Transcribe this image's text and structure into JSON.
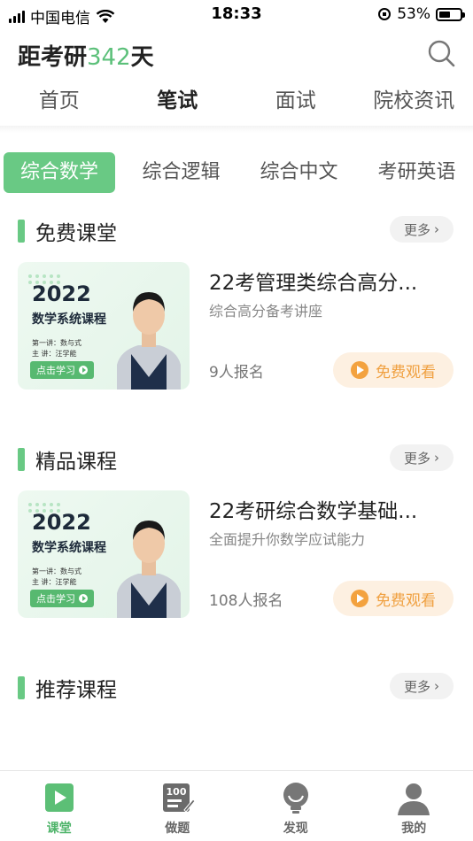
{
  "status_bar": {
    "carrier": "中国电信",
    "time": "18:33",
    "battery": "53%",
    "battery_level": 0.53
  },
  "header": {
    "title_prefix": "距考研",
    "days": "342",
    "title_suffix": "天"
  },
  "main_tabs": [
    {
      "label": "首页",
      "active": false
    },
    {
      "label": "笔试",
      "active": true
    },
    {
      "label": "面试",
      "active": false
    },
    {
      "label": "院校资讯",
      "active": false
    }
  ],
  "subject_tabs": [
    {
      "label": "综合数学",
      "active": true
    },
    {
      "label": "综合逻辑",
      "active": false
    },
    {
      "label": "综合中文",
      "active": false
    },
    {
      "label": "考研英语",
      "active": false
    }
  ],
  "sections": [
    {
      "title": "免费课堂",
      "more": "更多",
      "course": {
        "thumb_year": "2022",
        "thumb_title": "数学系统课程",
        "thumb_line1": "第一讲：数与式",
        "thumb_line2": "主 讲：汪学能",
        "thumb_cta": "点击学习",
        "title": "22考管理类综合高分...",
        "desc": "综合高分备考讲座",
        "count": "9人报名",
        "button": "免费观看"
      }
    },
    {
      "title": "精品课程",
      "more": "更多",
      "course": {
        "thumb_year": "2022",
        "thumb_title": "数学系统课程",
        "thumb_line1": "第一讲：数与式",
        "thumb_line2": "主 讲：汪学能",
        "thumb_cta": "点击学习",
        "title": "22考研综合数学基础...",
        "desc": "全面提升你数学应试能力",
        "count": "108人报名",
        "button": "免费观看"
      }
    },
    {
      "title": "推荐课程",
      "more": "更多"
    }
  ],
  "bottom_nav": [
    {
      "label": "课堂",
      "icon": "classroom-icon",
      "active": true
    },
    {
      "label": "做题",
      "icon": "exercise-icon",
      "badge": "100",
      "active": false
    },
    {
      "label": "发现",
      "icon": "lightbulb-icon",
      "active": false
    },
    {
      "label": "我的",
      "icon": "profile-icon",
      "active": false
    }
  ],
  "colors": {
    "accent": "#69c984",
    "orange": "#f3a23f"
  }
}
